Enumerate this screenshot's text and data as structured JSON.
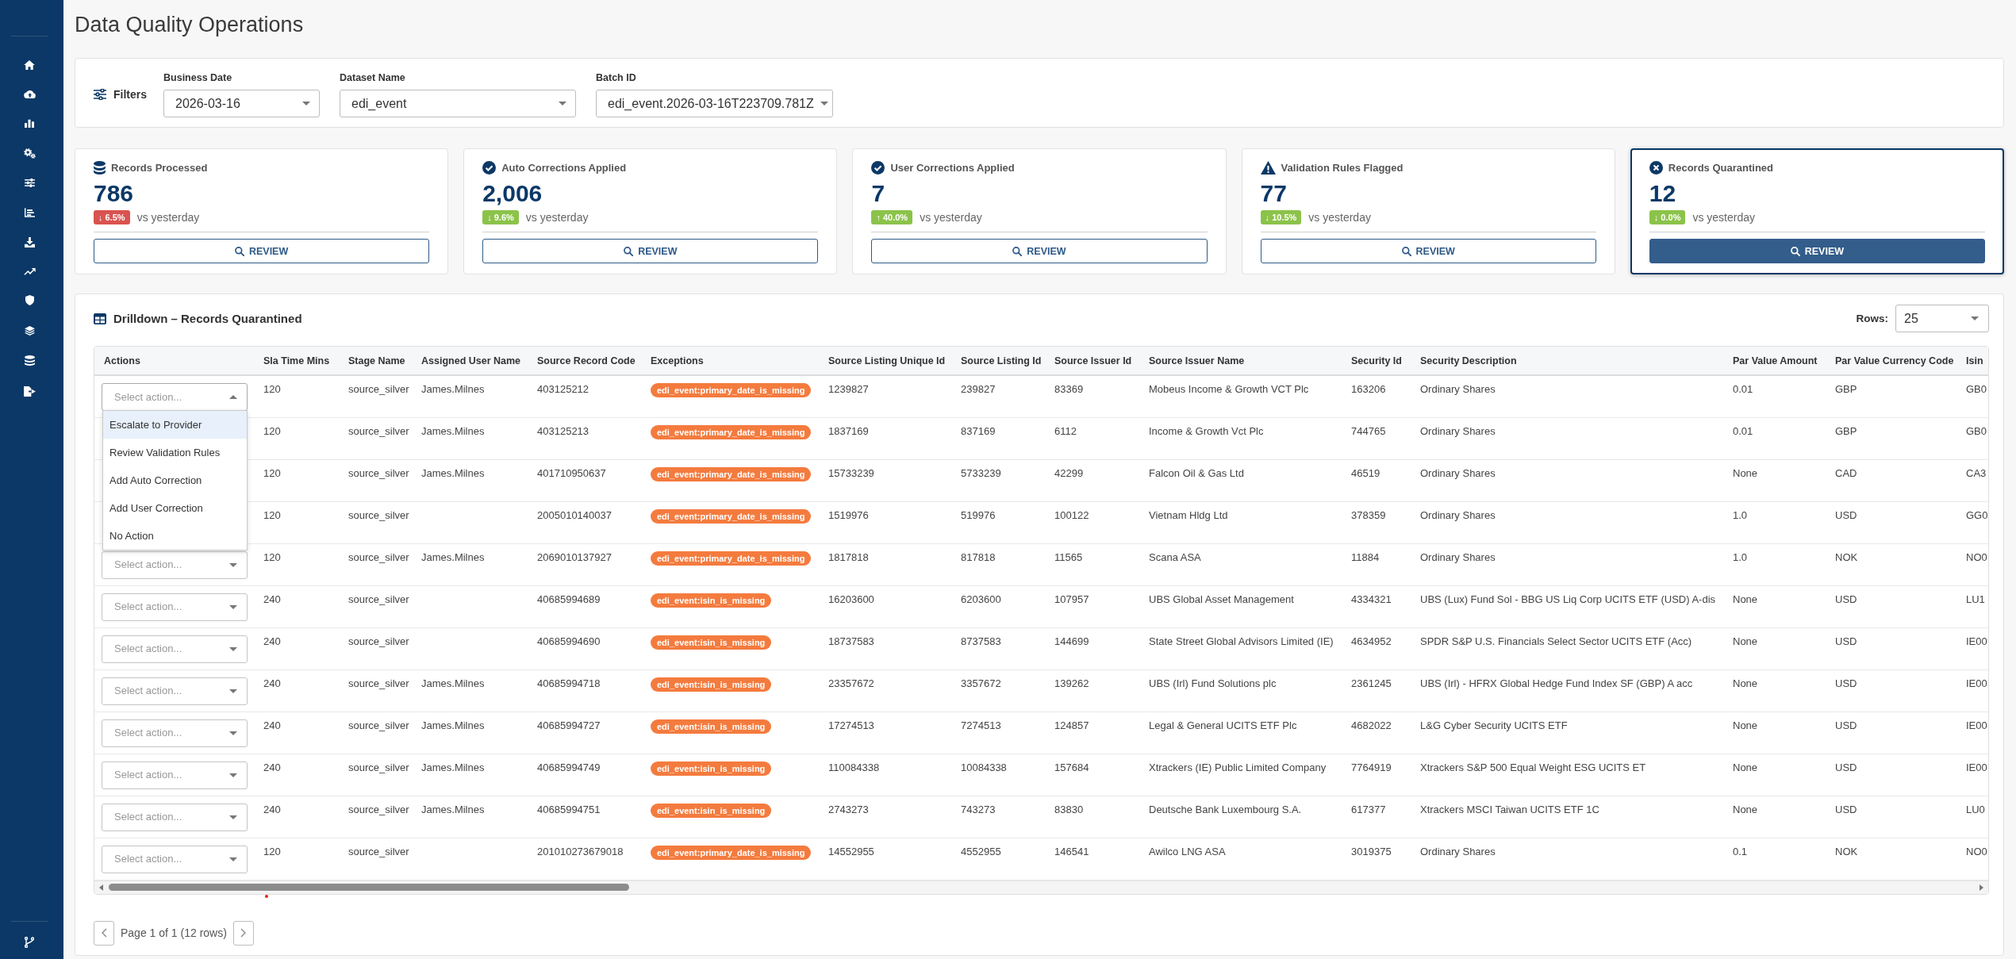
{
  "page": {
    "title": "Data Quality Operations"
  },
  "filters": {
    "label": "Filters",
    "fields": [
      {
        "label": "Business Date",
        "value": "2026-03-16"
      },
      {
        "label": "Dataset Name",
        "value": "edi_event"
      },
      {
        "label": "Batch ID",
        "value": "edi_event.2026-03-16T223709.781Z"
      }
    ]
  },
  "kpis": [
    {
      "kind": "total",
      "title": "Records Processed",
      "value": "786",
      "change": {
        "text": "↓ 6.5%",
        "color": "#d9534f"
      },
      "comparison": "vs yesterday",
      "button": "REVIEW",
      "selected": false
    },
    {
      "kind": "corrected",
      "title": "Auto Corrections Applied",
      "value": "2,006",
      "change": {
        "text": "↓ 9.6%",
        "color": "#8bc34a"
      },
      "comparison": "vs yesterday",
      "button": "REVIEW",
      "selected": false
    },
    {
      "kind": "corrected",
      "title": "User Corrections Applied",
      "value": "7",
      "change": {
        "text": "↑ 40.0%",
        "color": "#8bc34a"
      },
      "comparison": "vs yesterday",
      "button": "REVIEW",
      "selected": false
    },
    {
      "kind": "flagged",
      "title": "Validation Rules Flagged",
      "value": "77",
      "change": {
        "text": "↓ 10.5%",
        "color": "#8bc34a"
      },
      "comparison": "vs yesterday",
      "button": "REVIEW",
      "selected": false
    },
    {
      "kind": "quarantined",
      "title": "Records Quarantined",
      "value": "12",
      "change": {
        "text": "↓ 0.0%",
        "color": "#8bc34a"
      },
      "comparison": "vs yesterday",
      "button": "REVIEW",
      "selected": true
    }
  ],
  "drilldown": {
    "title": "Drilldown – Records Quarantined",
    "rows_label": "Rows:",
    "rows_value": "25",
    "columns": [
      {
        "label": "Actions",
        "kind": "action"
      },
      {
        "label": "Sla Time Mins",
        "kind": "text"
      },
      {
        "label": "Stage Name",
        "kind": "text"
      },
      {
        "label": "Assigned User Name",
        "kind": "text"
      },
      {
        "label": "Source Record Code",
        "kind": "text"
      },
      {
        "label": "Exceptions",
        "kind": "tag"
      },
      {
        "label": "Source Listing Unique Id",
        "kind": "text"
      },
      {
        "label": "Source Listing Id",
        "kind": "text"
      },
      {
        "label": "Source Issuer Id",
        "kind": "text"
      },
      {
        "label": "Source Issuer Name",
        "kind": "text"
      },
      {
        "label": "Security Id",
        "kind": "text"
      },
      {
        "label": "Security Description",
        "kind": "text"
      },
      {
        "label": "Par Value Amount",
        "kind": "text"
      },
      {
        "label": "Par Value Currency Code",
        "kind": "text"
      },
      {
        "label": "Isin",
        "kind": "text"
      }
    ],
    "rows": [
      {
        "cells": [
          {
            "placeholder": "Select action...",
            "expanded": true
          },
          "120",
          "source_silver",
          "James.Milnes",
          "403125212",
          "edi_event:primary_date_is_missing",
          "1239827",
          "239827",
          "83369",
          "Mobeus Income & Growth VCT Plc",
          "163206",
          "Ordinary Shares",
          "0.01",
          "GBP",
          "GB0"
        ]
      },
      {
        "cells": [
          "",
          "120",
          "source_silver",
          "James.Milnes",
          "403125213",
          "edi_event:primary_date_is_missing",
          "1837169",
          "837169",
          "6112",
          "Income & Growth Vct Plc",
          "744765",
          "Ordinary Shares",
          "0.01",
          "GBP",
          "GB0"
        ]
      },
      {
        "cells": [
          "",
          "120",
          "source_silver",
          "James.Milnes",
          "401710950637",
          "edi_event:primary_date_is_missing",
          "15733239",
          "5733239",
          "42299",
          "Falcon Oil & Gas Ltd",
          "46519",
          "Ordinary Shares",
          "None",
          "CAD",
          "CA3"
        ]
      },
      {
        "cells": [
          "",
          "120",
          "source_silver",
          "",
          "2005010140037",
          "edi_event:primary_date_is_missing",
          "1519976",
          "519976",
          "100122",
          "Vietnam Hldg Ltd",
          "378359",
          "Ordinary Shares",
          "1.0",
          "USD",
          "GG0"
        ]
      },
      {
        "cells": [
          {
            "placeholder": "Select action...",
            "expanded": false
          },
          "120",
          "source_silver",
          "James.Milnes",
          "2069010137927",
          "edi_event:primary_date_is_missing",
          "1817818",
          "817818",
          "11565",
          "Scana ASA",
          "11884",
          "Ordinary Shares",
          "1.0",
          "NOK",
          "NO0"
        ]
      },
      {
        "cells": [
          {
            "placeholder": "Select action...",
            "expanded": false
          },
          "240",
          "source_silver",
          "",
          "40685994689",
          "edi_event:isin_is_missing",
          "16203600",
          "6203600",
          "107957",
          "UBS Global Asset Management",
          "4334321",
          "UBS (Lux) Fund Sol - BBG US Liq Corp UCITS ETF (USD) A-dis",
          "None",
          "USD",
          "LU1"
        ]
      },
      {
        "cells": [
          {
            "placeholder": "Select action...",
            "expanded": false
          },
          "240",
          "source_silver",
          "",
          "40685994690",
          "edi_event:isin_is_missing",
          "18737583",
          "8737583",
          "144699",
          "State Street Global Advisors Limited (IE)",
          "4634952",
          "SPDR S&P U.S. Financials Select Sector UCITS ETF (Acc)",
          "None",
          "USD",
          "IE00"
        ]
      },
      {
        "cells": [
          {
            "placeholder": "Select action...",
            "expanded": false
          },
          "240",
          "source_silver",
          "James.Milnes",
          "40685994718",
          "edi_event:isin_is_missing",
          "23357672",
          "3357672",
          "139262",
          "UBS (Irl) Fund Solutions plc",
          "2361245",
          "UBS (Irl) - HFRX Global Hedge Fund Index SF (GBP) A acc",
          "None",
          "USD",
          "IE00"
        ]
      },
      {
        "cells": [
          {
            "placeholder": "Select action...",
            "expanded": false
          },
          "240",
          "source_silver",
          "James.Milnes",
          "40685994727",
          "edi_event:isin_is_missing",
          "17274513",
          "7274513",
          "124857",
          "Legal & General UCITS ETF Plc",
          "4682022",
          "L&G Cyber Security UCITS ETF",
          "None",
          "USD",
          "IE00"
        ]
      },
      {
        "cells": [
          {
            "placeholder": "Select action...",
            "expanded": false
          },
          "240",
          "source_silver",
          "James.Milnes",
          "40685994749",
          "edi_event:isin_is_missing",
          "110084338",
          "10084338",
          "157684",
          "Xtrackers (IE) Public Limited Company",
          "7764919",
          "Xtrackers S&P 500 Equal Weight ESG UCITS ET",
          "None",
          "USD",
          "IE00"
        ]
      },
      {
        "cells": [
          {
            "placeholder": "Select action...",
            "expanded": false
          },
          "240",
          "source_silver",
          "James.Milnes",
          "40685994751",
          "edi_event:isin_is_missing",
          "2743273",
          "743273",
          "83830",
          "Deutsche Bank Luxembourg S.A.",
          "617377",
          "Xtrackers MSCI Taiwan UCITS ETF 1C",
          "None",
          "USD",
          "LU0"
        ]
      },
      {
        "cells": [
          {
            "placeholder": "Select action...",
            "expanded": false
          },
          "120",
          "source_silver",
          "",
          "201010273679018",
          "edi_event:primary_date_is_missing",
          "14552955",
          "4552955",
          "146541",
          "Awilco LNG ASA",
          "3019375",
          "Ordinary Shares",
          "0.1",
          "NOK",
          "NO0"
        ]
      }
    ],
    "action_menu": {
      "options": [
        {
          "label": "Escalate to Provider",
          "selected": true
        },
        {
          "label": "Review Validation Rules",
          "selected": false
        },
        {
          "label": "Add Auto Correction",
          "selected": false
        },
        {
          "label": "Add User Correction",
          "selected": false
        },
        {
          "label": "No Action",
          "selected": false
        }
      ]
    },
    "pagination": "Page 1 of 1 (12 rows)"
  }
}
